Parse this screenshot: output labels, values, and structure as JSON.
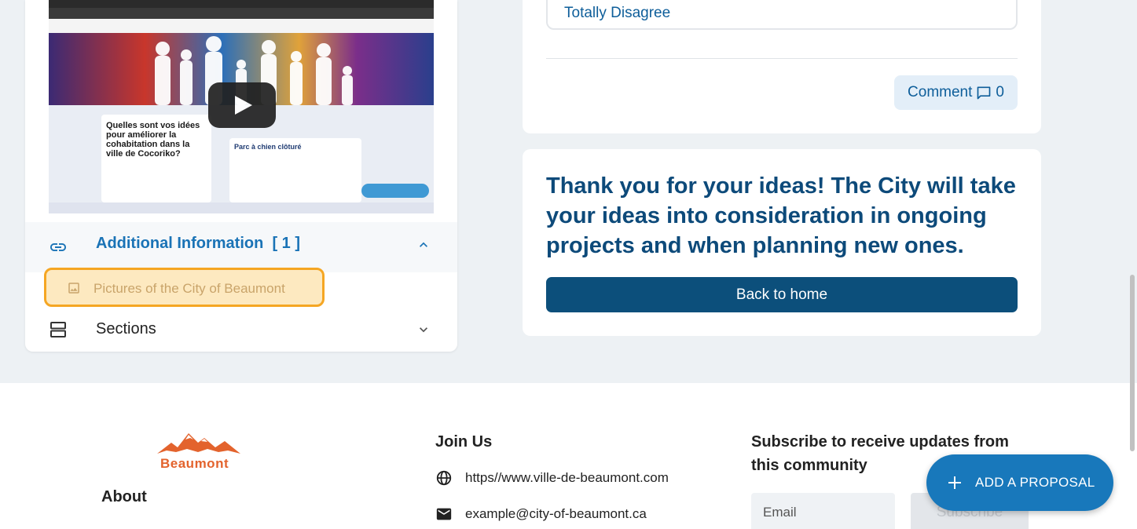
{
  "video": {
    "question": "Quelles sont vos idées pour améliorer la cohabitation dans la ville de Cocoriko?",
    "panel_title": "Parc à chien clôturé"
  },
  "sidebar": {
    "additional_info_label": "Additional Information",
    "additional_info_count": "[ 1 ]",
    "picture_item": "Pictures of the City of Beaumont",
    "sections_label": "Sections"
  },
  "survey": {
    "choice_label": "Totally Disagree",
    "comment_label": "Comment",
    "comment_count": "0"
  },
  "thanks": {
    "message": "Thank you for your ideas! The City will take your ideas into consideration in ongoing projects and when planning new ones.",
    "back_button": "Back to home"
  },
  "footer": {
    "logo_text": "Beaumont",
    "about": "About",
    "join_title": "Join Us",
    "website": "https//www.ville-de-beaumont.com",
    "email": "example@city-of-beaumont.ca",
    "subscribe_title": "Subscribe to receive updates from this community",
    "email_placeholder": "Email",
    "subscribe_button": "Subscribe"
  },
  "fab": {
    "label": "ADD A PROPOSAL"
  },
  "colors": {
    "primary": "#0c4f7b",
    "link": "#1a73b6",
    "highlight": "#f5a623",
    "logo": "#e3632d"
  }
}
